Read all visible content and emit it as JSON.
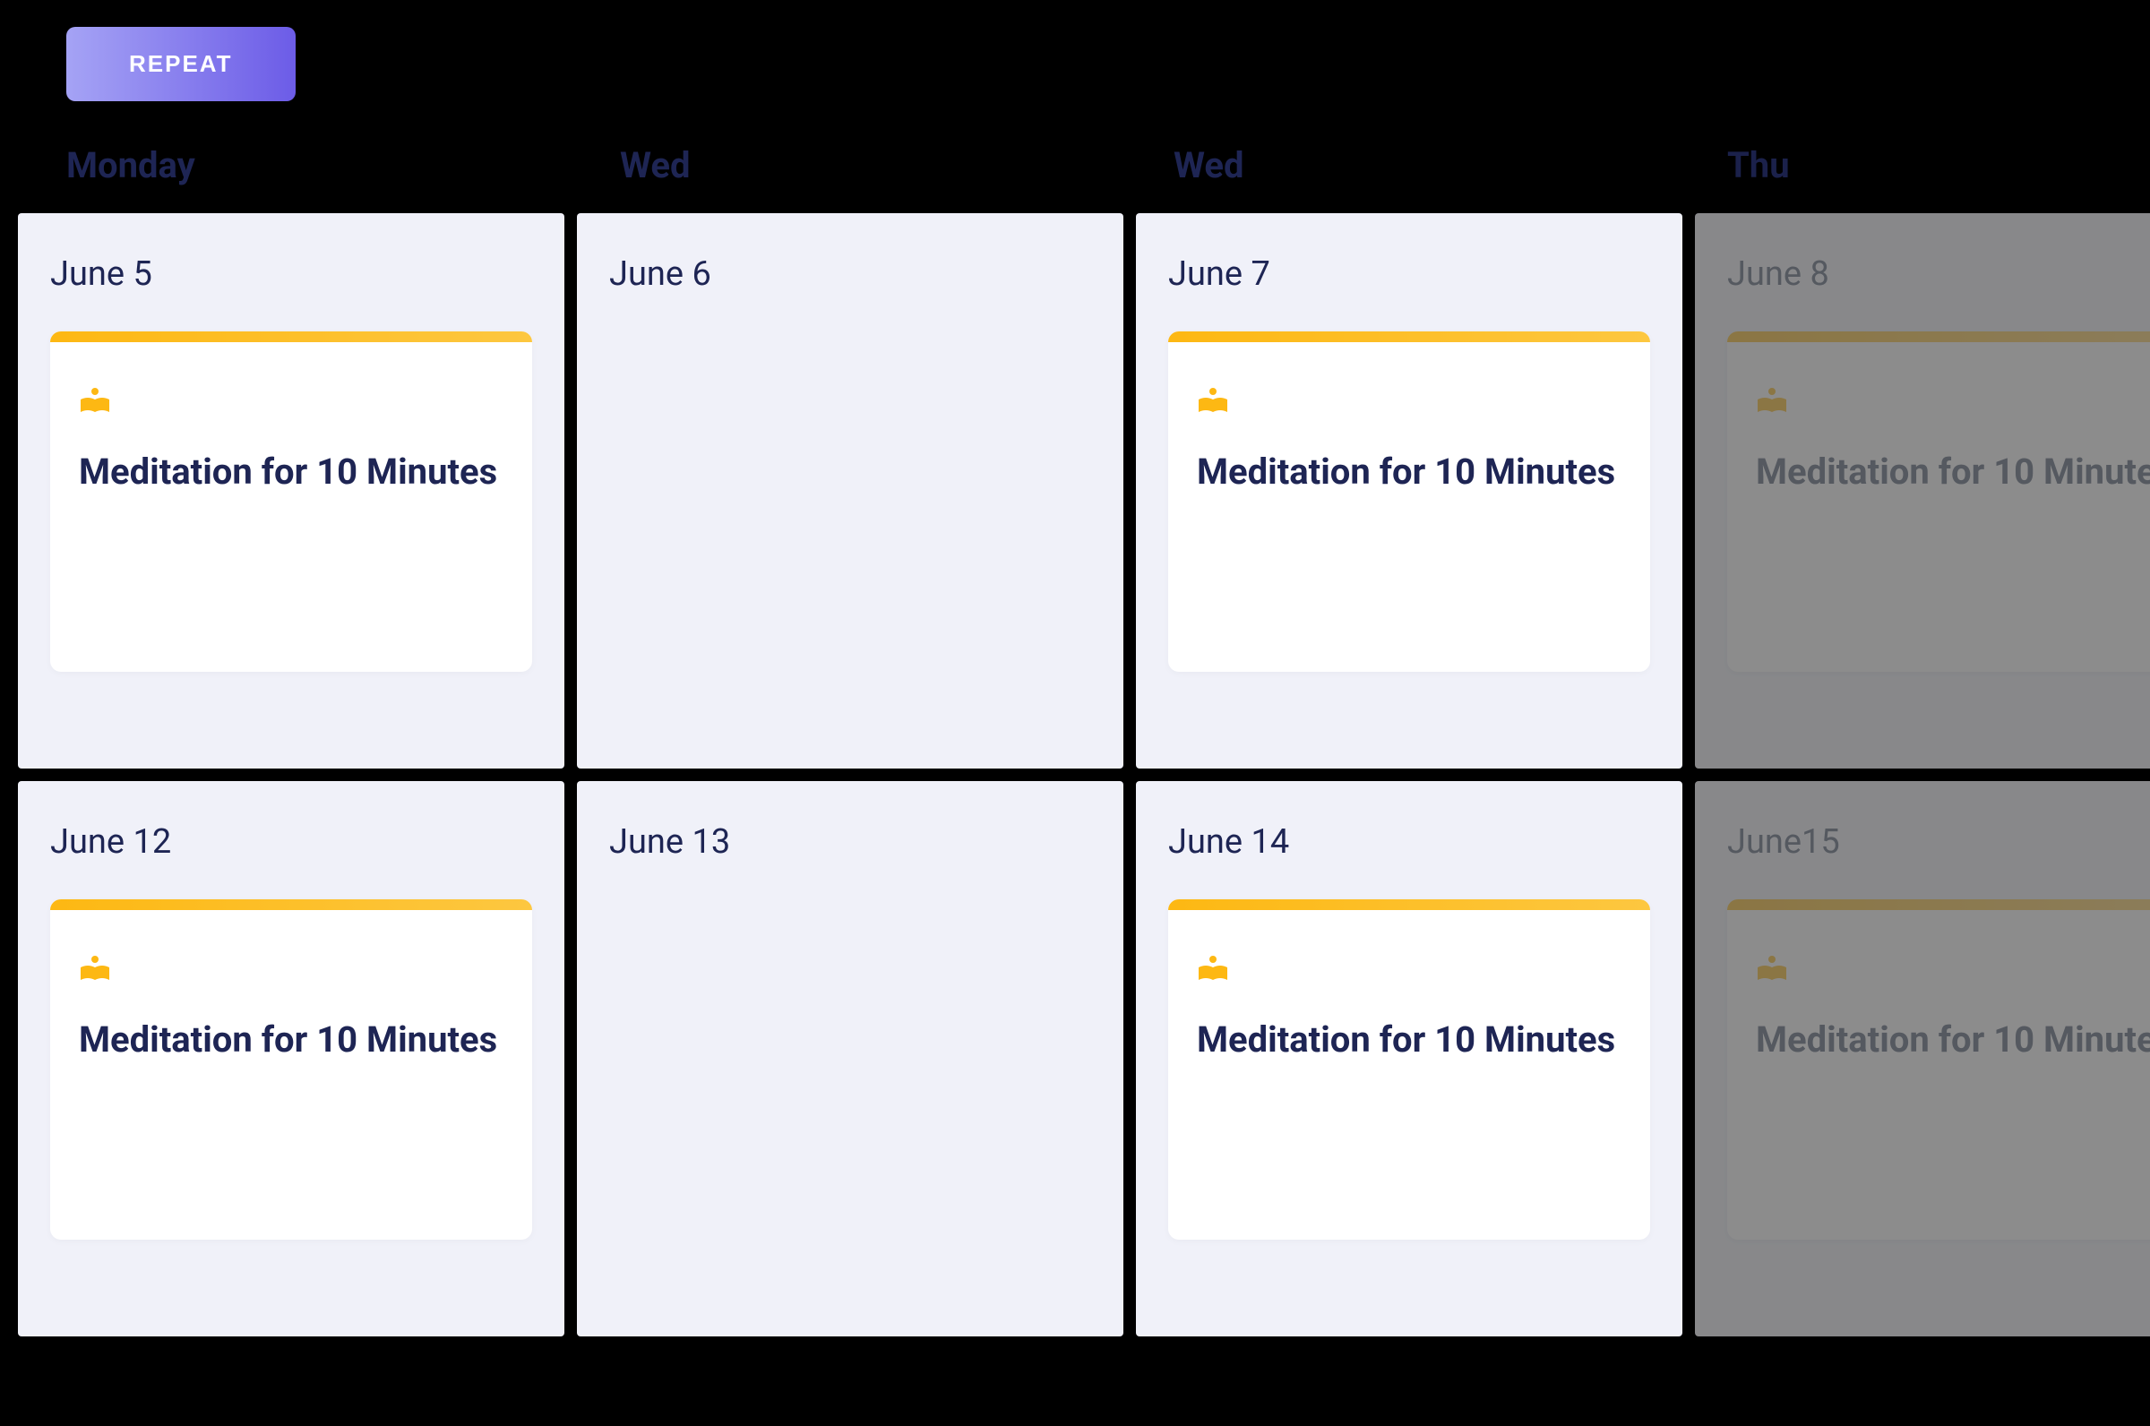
{
  "toolbar": {
    "repeat_label": "REPEAT"
  },
  "header": {
    "columns": [
      {
        "label": "Monday"
      },
      {
        "label": "Wed"
      },
      {
        "label": "Wed"
      },
      {
        "label": "Thu"
      }
    ]
  },
  "task": {
    "icon": "book-icon",
    "title": "Meditation for 10 Minutes",
    "accent_color": "#fdb813"
  },
  "rows": [
    {
      "cells": [
        {
          "date": "June 5",
          "has_task": true,
          "faded": false
        },
        {
          "date": "June 6",
          "has_task": false,
          "faded": false
        },
        {
          "date": "June 7",
          "has_task": true,
          "faded": false
        },
        {
          "date": "June 8",
          "has_task": true,
          "faded": true
        }
      ]
    },
    {
      "cells": [
        {
          "date": "June 12",
          "has_task": true,
          "faded": false
        },
        {
          "date": "June 13",
          "has_task": false,
          "faded": false
        },
        {
          "date": "June 14",
          "has_task": true,
          "faded": false
        },
        {
          "date": "June15",
          "has_task": true,
          "faded": true
        }
      ]
    }
  ]
}
